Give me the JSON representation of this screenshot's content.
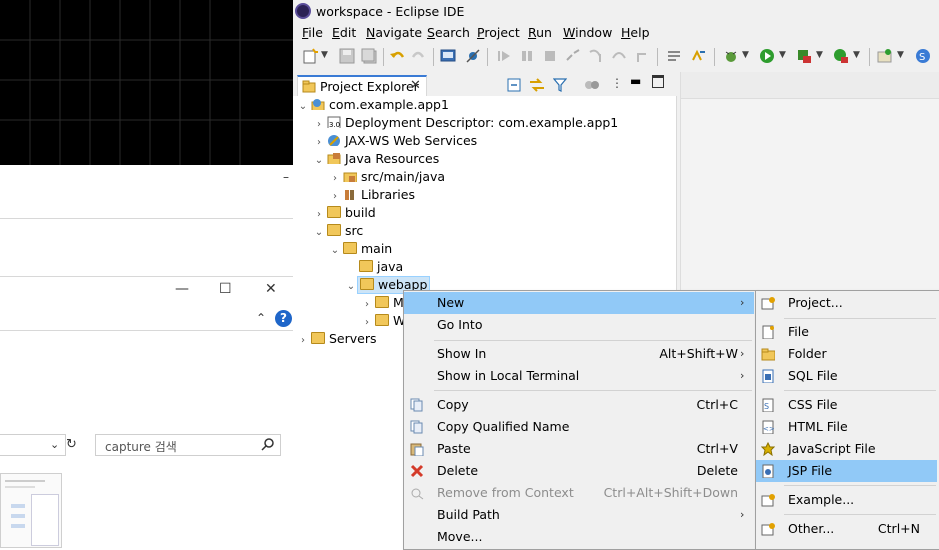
{
  "background_window": {
    "search_placeholder": "capture 검색"
  },
  "eclipse": {
    "title": "workspace - Eclipse IDE",
    "menubar": [
      "File",
      "Edit",
      "Navigate",
      "Search",
      "Project",
      "Run",
      "Window",
      "Help"
    ],
    "view_tab": "Project Explorer",
    "tree": [
      {
        "label": "com.example.app1",
        "icon": "web-project-icon"
      },
      {
        "label": "Deployment Descriptor: com.example.app1",
        "icon": "deployment-descriptor-icon"
      },
      {
        "label": "JAX-WS Web Services",
        "icon": "web-services-icon"
      },
      {
        "label": "Java Resources",
        "icon": "java-resources-icon"
      },
      {
        "label": "src/main/java",
        "icon": "source-folder-icon"
      },
      {
        "label": "Libraries",
        "icon": "libraries-icon"
      },
      {
        "label": "build",
        "icon": "folder-icon"
      },
      {
        "label": "src",
        "icon": "folder-icon"
      },
      {
        "label": "main",
        "icon": "folder-icon"
      },
      {
        "label": "java",
        "icon": "folder-icon"
      },
      {
        "label": "webapp",
        "icon": "folder-icon"
      },
      {
        "label": "M",
        "icon": "folder-icon"
      },
      {
        "label": "W",
        "icon": "folder-icon"
      },
      {
        "label": "Servers",
        "icon": "folder-icon"
      }
    ]
  },
  "context_menu": [
    {
      "label": "New",
      "shortcut": "",
      "submenu": true,
      "highlighted": true
    },
    {
      "label": "Go Into",
      "shortcut": ""
    },
    {
      "label": "Show In",
      "shortcut": "Alt+Shift+W",
      "submenu": true
    },
    {
      "label": "Show in Local Terminal",
      "shortcut": "",
      "submenu": true
    },
    {
      "label": "Copy",
      "shortcut": "Ctrl+C"
    },
    {
      "label": "Copy Qualified Name",
      "shortcut": ""
    },
    {
      "label": "Paste",
      "shortcut": "Ctrl+V"
    },
    {
      "label": "Delete",
      "shortcut": "Delete"
    },
    {
      "label": "Remove from Context",
      "shortcut": "Ctrl+Alt+Shift+Down",
      "disabled": true
    },
    {
      "label": "Build Path",
      "shortcut": "",
      "submenu": true
    },
    {
      "label": "Move...",
      "shortcut": ""
    }
  ],
  "new_submenu": [
    {
      "label": "Project...",
      "icon": "new-project-icon"
    },
    {
      "label": "File",
      "icon": "new-file-icon"
    },
    {
      "label": "Folder",
      "icon": "new-folder-icon"
    },
    {
      "label": "SQL File",
      "icon": "sql-file-icon"
    },
    {
      "label": "CSS File",
      "icon": "css-file-icon"
    },
    {
      "label": "HTML File",
      "icon": "html-file-icon"
    },
    {
      "label": "JavaScript File",
      "icon": "javascript-file-icon"
    },
    {
      "label": "JSP File",
      "icon": "jsp-file-icon",
      "highlighted": true
    },
    {
      "label": "Example...",
      "icon": "example-icon"
    },
    {
      "label": "Other...",
      "icon": "other-wizard-icon",
      "shortcut": "Ctrl+N"
    }
  ],
  "colors": {
    "menu_highlight": "#91c9f7",
    "selection": "#cce4f7",
    "tab_accent": "#3a7bd5"
  }
}
